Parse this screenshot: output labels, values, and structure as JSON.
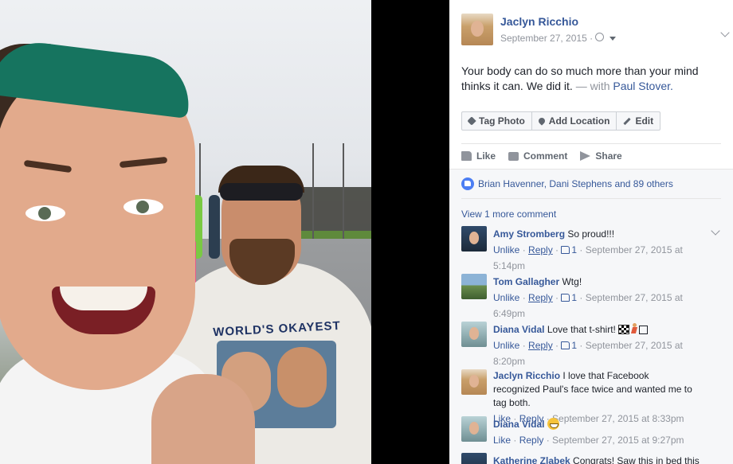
{
  "post": {
    "author": "Jaclyn Ricchio",
    "date": "September 27, 2015 ·",
    "privacy_icon": "globe-icon",
    "text": "Your body can do so much more than your mind thinks it can. We did it.",
    "with_label": "— with",
    "tagged_person": "Paul Stover."
  },
  "photo": {
    "shirt_text": "WORLD'S OKAYEST"
  },
  "photo_actions": {
    "tag_photo": "Tag Photo",
    "add_location": "Add Location",
    "edit": "Edit"
  },
  "actions": {
    "like": "Like",
    "comment": "Comment",
    "share": "Share"
  },
  "reactions": {
    "summary": "Brian Havenner, Dani Stephens and 89 others"
  },
  "comments_section": {
    "view_more": "View 1 more comment"
  },
  "comments": [
    {
      "author": "Amy Stromberg",
      "text": "So proud!!!",
      "like_action": "Unlike",
      "reply_label": "Reply",
      "like_count": "1",
      "timestamp": "September 27, 2015 at 5:14pm"
    },
    {
      "author": "Tom Gallagher",
      "text": "Wtg!",
      "like_action": "Unlike",
      "reply_label": "Reply",
      "like_count": "1",
      "timestamp": "September 27, 2015 at 6:49pm"
    },
    {
      "author": "Diana Vidal",
      "text": "Love that t-shirt!",
      "like_action": "Unlike",
      "reply_label": "Reply",
      "like_count": "1",
      "timestamp": "September 27, 2015 at 8:20pm"
    },
    {
      "author": "Jaclyn Ricchio",
      "text": "I love that Facebook recognized Paul's face twice and wanted me to tag both.",
      "like_action": "Like",
      "reply_label": "Reply",
      "timestamp": "September 27, 2015 at 8:33pm"
    },
    {
      "author": "Diana Vidal",
      "text": "",
      "like_action": "Like",
      "reply_label": "Reply",
      "timestamp": "September 27, 2015 at 9:27pm"
    },
    {
      "author": "Katherine Zlabek",
      "text": "Congrats! Saw this in bed this"
    }
  ],
  "colors": {
    "link": "#365899",
    "meta": "#90949c",
    "panel_bg": "#ffffff",
    "comments_bg": "#f6f7f9"
  }
}
